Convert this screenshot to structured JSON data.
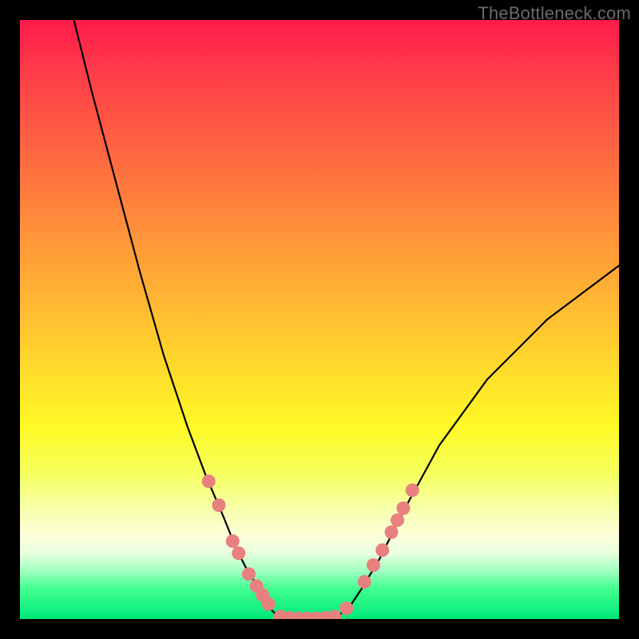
{
  "watermark": "TheBottleneck.com",
  "chart_data": {
    "type": "line",
    "title": "",
    "xlabel": "",
    "ylabel": "",
    "xlim": [
      0,
      100
    ],
    "ylim": [
      0,
      100
    ],
    "grid": false,
    "series": [
      {
        "name": "left-curve",
        "x": [
          9,
          12,
          16,
          20,
          24,
          28,
          31,
          34,
          36,
          38,
          40,
          41,
          42,
          43
        ],
        "y": [
          100,
          88,
          73,
          58,
          44,
          32,
          24,
          17,
          12,
          8,
          5,
          3,
          1.5,
          0.5
        ]
      },
      {
        "name": "floor",
        "x": [
          43,
          45,
          47,
          49,
          51,
          53
        ],
        "y": [
          0.5,
          0,
          0,
          0,
          0,
          0.5
        ]
      },
      {
        "name": "right-curve",
        "x": [
          53,
          55,
          57,
          60,
          64,
          70,
          78,
          88,
          100
        ],
        "y": [
          0.5,
          2,
          5,
          10,
          18,
          29,
          40,
          50,
          59
        ]
      }
    ],
    "markers": [
      {
        "name": "left-marker",
        "x": 31.5,
        "y": 23
      },
      {
        "name": "left-marker",
        "x": 33.2,
        "y": 19
      },
      {
        "name": "left-marker",
        "x": 35.5,
        "y": 13
      },
      {
        "name": "left-marker",
        "x": 36.5,
        "y": 11
      },
      {
        "name": "left-marker",
        "x": 38.2,
        "y": 7.5
      },
      {
        "name": "left-marker",
        "x": 39.5,
        "y": 5.5
      },
      {
        "name": "left-marker",
        "x": 40.5,
        "y": 4
      },
      {
        "name": "left-marker",
        "x": 41.5,
        "y": 2.5
      },
      {
        "name": "floor-marker",
        "x": 43.5,
        "y": 0.4
      },
      {
        "name": "floor-marker",
        "x": 45,
        "y": 0.2
      },
      {
        "name": "floor-marker",
        "x": 46.5,
        "y": 0.1
      },
      {
        "name": "floor-marker",
        "x": 48,
        "y": 0.1
      },
      {
        "name": "floor-marker",
        "x": 49.5,
        "y": 0.1
      },
      {
        "name": "floor-marker",
        "x": 51,
        "y": 0.2
      },
      {
        "name": "floor-marker",
        "x": 52.5,
        "y": 0.4
      },
      {
        "name": "right-marker",
        "x": 54.5,
        "y": 1.8
      },
      {
        "name": "right-marker",
        "x": 57.5,
        "y": 6.2
      },
      {
        "name": "right-marker",
        "x": 59,
        "y": 9
      },
      {
        "name": "right-marker",
        "x": 60.5,
        "y": 11.5
      },
      {
        "name": "right-marker",
        "x": 62,
        "y": 14.5
      },
      {
        "name": "right-marker",
        "x": 63,
        "y": 16.5
      },
      {
        "name": "right-marker",
        "x": 64,
        "y": 18.5
      },
      {
        "name": "right-marker",
        "x": 65.5,
        "y": 21.5
      }
    ],
    "colors": {
      "curve": "#000000",
      "marker_fill": "#e98080",
      "marker_stroke": "#d86a6a"
    }
  }
}
